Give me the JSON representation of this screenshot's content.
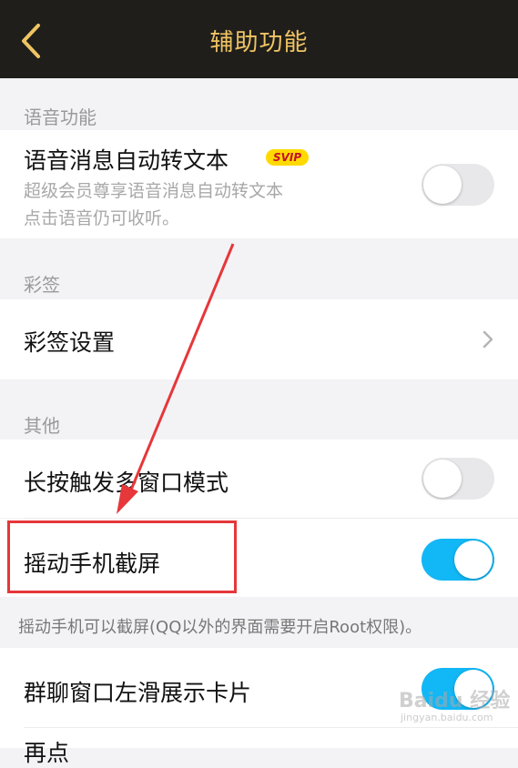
{
  "header": {
    "title": "辅助功能"
  },
  "sections": {
    "voice": {
      "label": "语音功能"
    },
    "caiqian": {
      "label": "彩签"
    },
    "other": {
      "label": "其他"
    }
  },
  "rows": {
    "voice_to_text": {
      "title": "语音消息自动转文本",
      "badge": "SVIP",
      "sub1": "超级会员尊享语音消息自动转文本",
      "sub2": "点击语音仍可收听。",
      "on": false
    },
    "caiqian_settings": {
      "title": "彩签设置"
    },
    "multi_window": {
      "title": "长按触发多窗口模式",
      "on": false
    },
    "shake_screenshot": {
      "title": "摇动手机截屏",
      "on": true
    },
    "group_swipe": {
      "title": "群聊窗口左滑展示卡片",
      "on": true
    },
    "partial_next": {
      "title": "再点"
    }
  },
  "footnote": "摇动手机可以截屏(QQ以外的界面需要开启Root权限)。",
  "watermark": {
    "text": "Baidu 经验",
    "sub": "jingyan.baidu.com"
  },
  "colors": {
    "nav_bg": "#1f1e1b",
    "nav_title": "#f0c463",
    "toggle_on": "#12b7f5",
    "annotation_red": "#e6373a"
  }
}
